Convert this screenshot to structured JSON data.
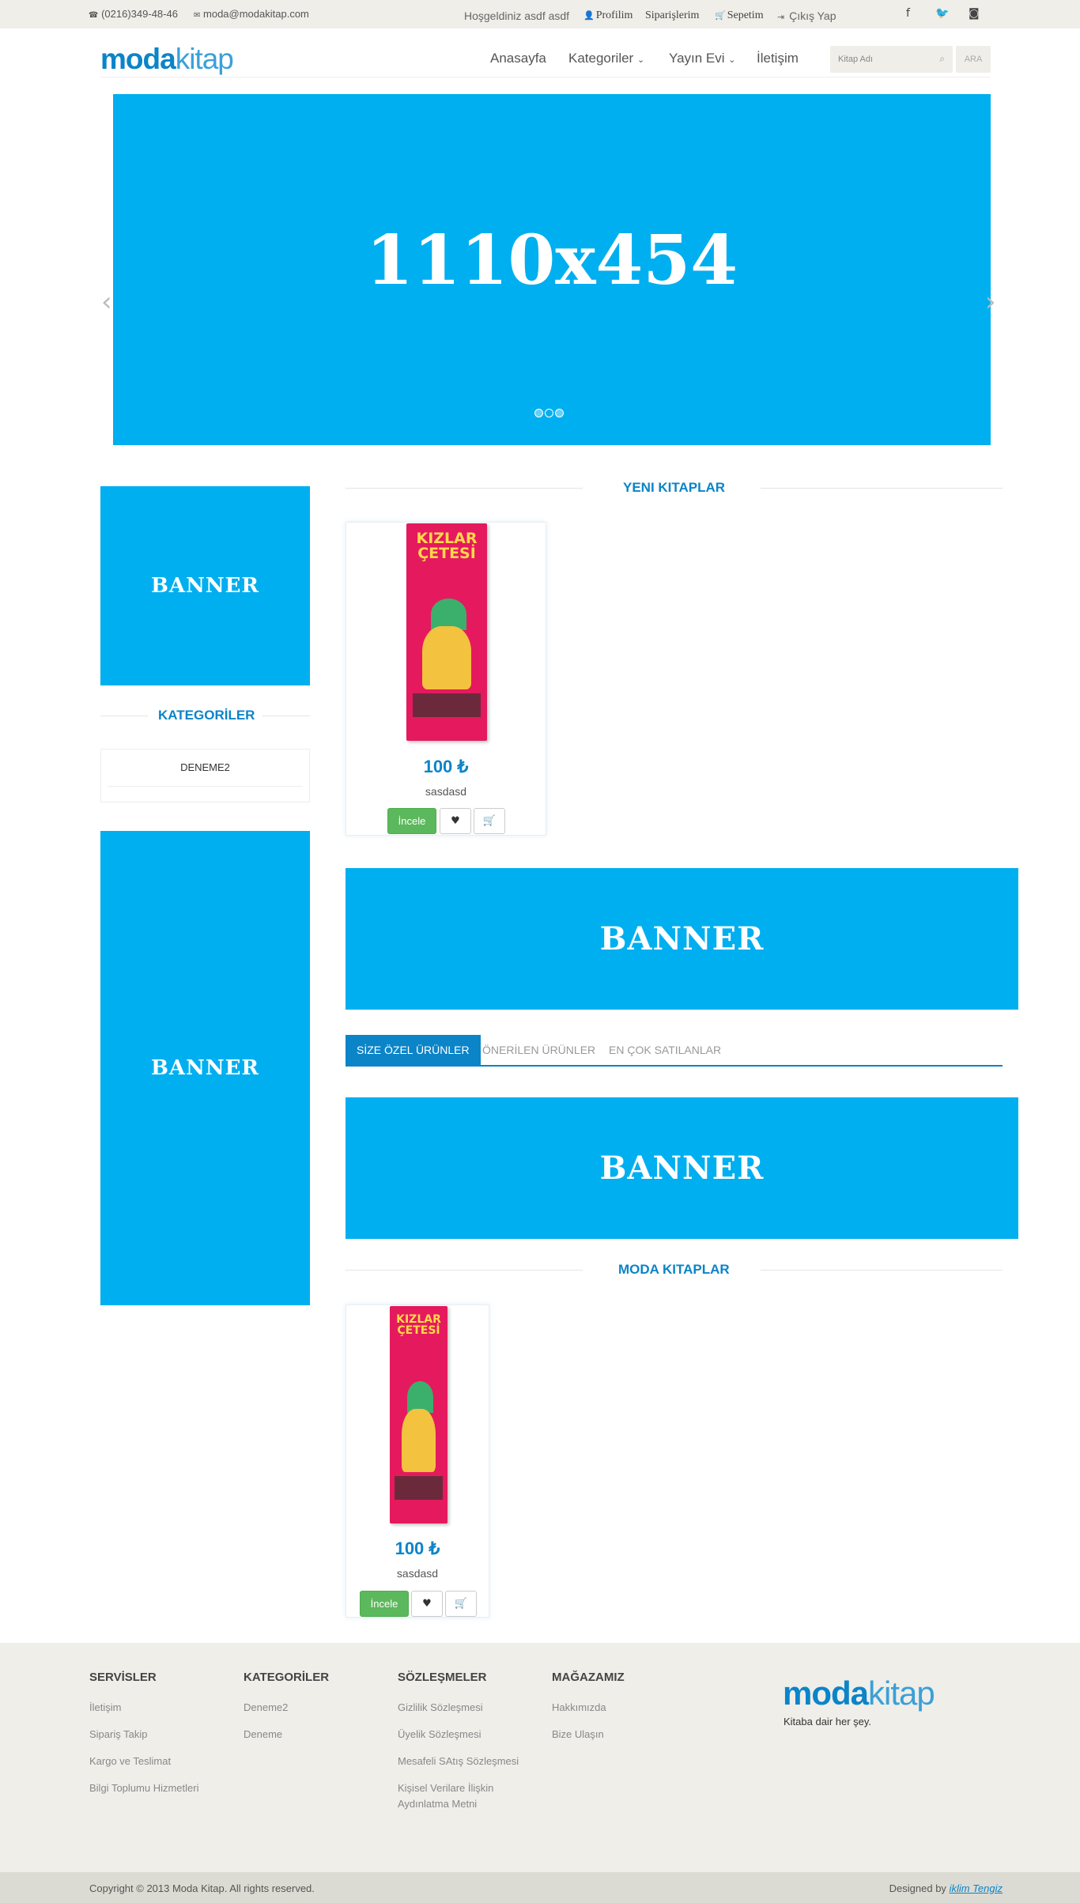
{
  "topbar": {
    "phone": "(0216)349-48-46",
    "email": "moda@modakitap.com",
    "welcome": "Hoşgeldiniz asdf asdf",
    "profile": "Profilim",
    "orders": "Siparişlerim",
    "cart": "Sepetim",
    "logout": "Çıkış Yap",
    "social": [
      "f",
      "t",
      "ig"
    ]
  },
  "header": {
    "logo_moda": "moda",
    "logo_kitap": "kitap",
    "nav": [
      "Anasayfa",
      "Kategoriler",
      "Yayın Evi",
      "İletişim"
    ],
    "search_placeholder": "Kitap Adı",
    "search_button": "ARA"
  },
  "slider": {
    "text": "1110x454",
    "dots": 3,
    "active_dot": 2
  },
  "sidebar": {
    "banner1": "BANNER",
    "categories_title": "KATEGORİLER",
    "categories": [
      "DENEME2"
    ],
    "banner2": "BANNER"
  },
  "main": {
    "new_books_title": "YENI KITAPLAR",
    "new_books": [
      {
        "price": "100 ₺",
        "name": "sasdasd",
        "cover_title": "KIZLAR ÇETESİ",
        "button": "İncele"
      }
    ],
    "banner_a": "BANNER",
    "tabs": [
      "SİZE ÖZEL ÜRÜNLER",
      "ÖNERİLEN ÜRÜNLER",
      "EN ÇOK SATILANLAR"
    ],
    "active_tab": 0,
    "banner_b": "BANNER",
    "moda_books_title": "MODA KITAPLAR",
    "moda_books": [
      {
        "price": "100 ₺",
        "name": "sasdasd",
        "cover_title": "KIZLAR ÇETESİ",
        "button": "İncele"
      }
    ]
  },
  "footer": {
    "columns": [
      {
        "title": "SERVİSLER",
        "links": [
          "İletişim",
          "Sipariş Takip",
          "Kargo ve Teslimat",
          "Bilgi Toplumu Hizmetleri"
        ]
      },
      {
        "title": "KATEGORİLER",
        "links": [
          "Deneme2",
          "Deneme"
        ]
      },
      {
        "title": "SÖZLEŞMELER",
        "links": [
          "Gizlilik Sözleşmesi",
          "Üyelik Sözleşmesi",
          "Mesafeli SAtış Sözleşmesi",
          "Kişisel Verilare İlişkin Aydınlatma Metni"
        ]
      },
      {
        "title": "MAĞAZAMIZ",
        "links": [
          "Hakkımızda",
          "Bize Ulaşın"
        ]
      }
    ],
    "logo_moda": "moda",
    "logo_kitap": "kitap",
    "tagline": "Kitaba dair her şey.",
    "copyright": "Copyright © 2013 Moda Kitap. All rights reserved.",
    "designed_by": "Designed by",
    "designer": "iklim Tengiz"
  },
  "colors": {
    "accent": "#0b84c8",
    "banner": "#00aff0",
    "button_green": "#5cb85c",
    "topbar_bg": "#efeee9"
  }
}
